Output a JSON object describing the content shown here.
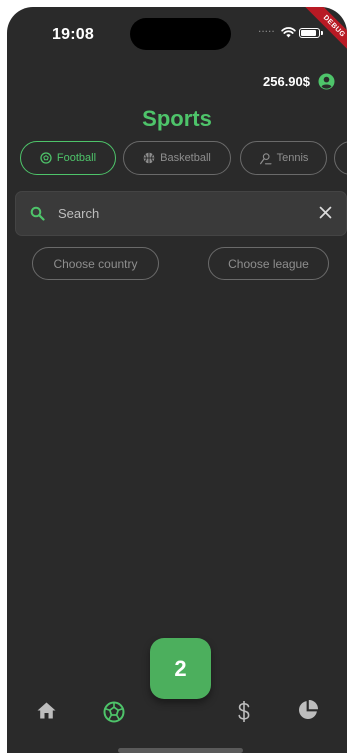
{
  "status_bar": {
    "time": "19:08",
    "debug_label": "DEBUG"
  },
  "header": {
    "balance": "256.90$"
  },
  "page": {
    "title": "Sports"
  },
  "sports_tabs": [
    {
      "label": "Football",
      "icon": "soccer-ball-icon",
      "active": true
    },
    {
      "label": "Basketball",
      "icon": "basketball-icon",
      "active": false
    },
    {
      "label": "Tennis",
      "icon": "tennis-player-icon",
      "active": false
    }
  ],
  "search": {
    "placeholder": "Search"
  },
  "filters": {
    "country": "Choose country",
    "league": "Choose league"
  },
  "fab": {
    "label": "2"
  },
  "bottom_nav": [
    {
      "name": "home",
      "icon": "home-icon",
      "active": false
    },
    {
      "name": "sports",
      "icon": "soccer-ball-icon",
      "active": true
    },
    {
      "name": "finance",
      "icon": "dollar-icon",
      "active": false
    },
    {
      "name": "stats",
      "icon": "pie-chart-icon",
      "active": false
    }
  ],
  "colors": {
    "accent": "#4ec46a",
    "background": "#2a2a2a",
    "chip_border": "#6a6a6a",
    "text_muted": "#8e8e8e"
  }
}
